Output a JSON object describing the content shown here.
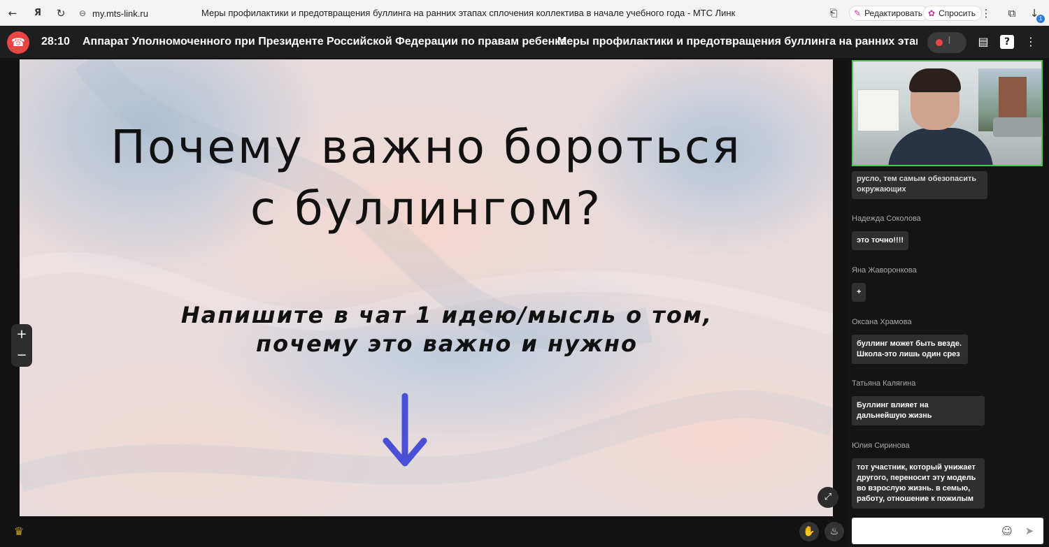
{
  "browser": {
    "url": "my.mts-link.ru",
    "page_title": "Меры профилактики и предотвращения буллинга на ранних этапах сплочения коллектива в начале учебного года - МТС Линк",
    "edit_label": "Редактировать",
    "ask_label": "Спросить",
    "downloads_badge": "1"
  },
  "header": {
    "timer": "28:10",
    "organizer": "Аппарат Уполномоченного при Президенте Российской Федерации по правам ребенка",
    "event_title": "Меры профилактики и предотвращения буллинга на ранних этапах"
  },
  "slide": {
    "title_line1": "Почему важно бороться",
    "title_line2": "с буллингом?",
    "subtitle_line1": "Напишите в чат 1 идею/мысль о том,",
    "subtitle_line2": "почему это важно и нужно",
    "arrow_color": "#4b4fd6"
  },
  "chat": {
    "partial_message": "русло, тем самым обезопасить окружающих",
    "messages": [
      {
        "author": "Надежда Соколова",
        "text": "это точно!!!!"
      },
      {
        "author": "Яна Жаворонкова",
        "text": "+"
      },
      {
        "author": "Оксана Храмова",
        "text": "буллинг может быть везде. Школа-это лишь один срез"
      },
      {
        "author": "Татьяна Калягина",
        "text": "Буллинг влияет на дальнейшую жизнь"
      },
      {
        "author": "Юлия Сиринова",
        "text": "тот участник, который унижает другого, переносит эту модель во взрослую жизнь. в семью, работу, отношение к пожилым"
      }
    ],
    "input_value": "",
    "input_placeholder": ""
  },
  "colors": {
    "hangup": "#e94545",
    "speaker_border": "#4cc94c",
    "header_bg": "#1e1e1e"
  }
}
